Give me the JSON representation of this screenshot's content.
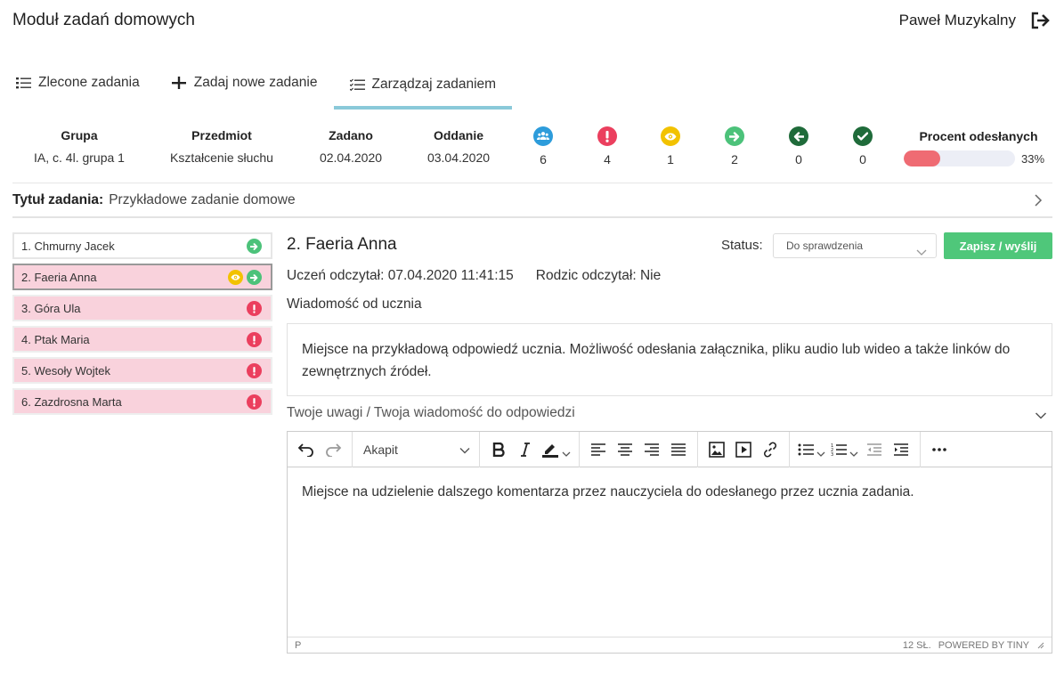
{
  "app": {
    "title": "Moduł zadań domowych",
    "user": "Paweł Muzykalny"
  },
  "tabs": [
    {
      "label": "Zlecone zadania",
      "icon": "list-icon"
    },
    {
      "label": "Zadaj nowe zadanie",
      "icon": "plus-icon"
    },
    {
      "label": "Zarządzaj zadaniem",
      "icon": "checklist-icon",
      "active": true
    }
  ],
  "summary": {
    "group_label": "Grupa",
    "group": "IA, c. 4l. grupa 1",
    "subject_label": "Przedmiot",
    "subject": "Kształcenie słuchu",
    "assigned_label": "Zadano",
    "assigned": "02.04.2020",
    "due_label": "Oddanie",
    "due": "03.04.2020",
    "counters": [
      {
        "icon": "users-icon",
        "color": "#2d9cdb",
        "value": "6"
      },
      {
        "icon": "exclamation-icon",
        "color": "#eb3f5e",
        "value": "4"
      },
      {
        "icon": "eye-icon",
        "color": "#f2c200",
        "value": "1"
      },
      {
        "icon": "arrow-right-icon",
        "color": "#4cc27a",
        "value": "2"
      },
      {
        "icon": "arrow-left-icon",
        "color": "#1f6b3a",
        "value": "0"
      },
      {
        "icon": "check-icon",
        "color": "#1f6b3a",
        "value": "0"
      }
    ],
    "progress_label": "Procent odesłanych",
    "progress_text": "33%",
    "progress_fraction": 0.33
  },
  "task": {
    "title_label": "Tytuł zadania:",
    "title": "Przykładowe zadanie domowe"
  },
  "students": [
    {
      "label": "1. Chmurny Jacek",
      "state": "white",
      "icons": [
        "arrow-right-icon"
      ]
    },
    {
      "label": "2. Faeria Anna",
      "state": "selected",
      "icons": [
        "eye-icon",
        "arrow-right-icon"
      ]
    },
    {
      "label": "3. Góra Ula",
      "state": "pink",
      "icons": [
        "exclamation-icon"
      ]
    },
    {
      "label": "4. Ptak Maria",
      "state": "pink",
      "icons": [
        "exclamation-icon"
      ]
    },
    {
      "label": "5. Wesoły Wojtek",
      "state": "pink",
      "icons": [
        "exclamation-icon"
      ]
    },
    {
      "label": "6. Zazdrosna Marta",
      "state": "pink",
      "icons": [
        "exclamation-icon"
      ]
    }
  ],
  "detail": {
    "name": "2. Faeria Anna",
    "status_label": "Status:",
    "status_value": "Do sprawdzenia",
    "save_label": "Zapisz / wyślij",
    "student_read": "Uczeń odczytał: 07.04.2020 11:41:15",
    "parent_read": "Rodzic odczytał: Nie",
    "message_label": "Wiadomość od ucznia",
    "message": "Miejsce na przykładową odpowiedź ucznia. Możliwość odesłania załącznika, pliku audio lub wideo a także linków do zewnętrznych źródeł.",
    "comment_label": "Twoje uwagi / Twoja wiadomość do odpowiedzi"
  },
  "editor": {
    "format": "Akapit",
    "content": "Miejsce na udzielenie dalszego komentarza przez nauczyciela do odesłanego przez ucznia zadania.",
    "path": "P",
    "word_count": "12 SŁ.",
    "powered": "POWERED BY TINY"
  }
}
